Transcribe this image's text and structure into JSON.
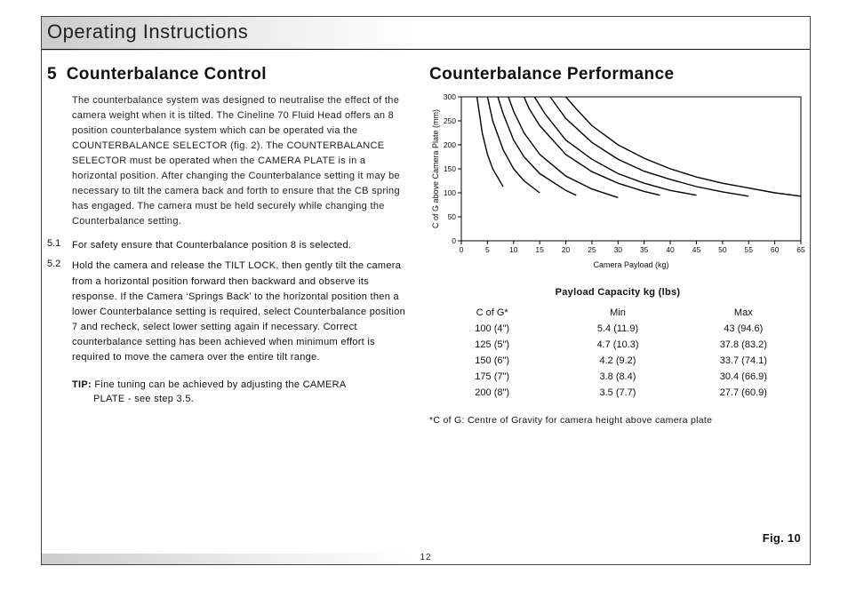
{
  "header": {
    "title": "Operating Instructions"
  },
  "left": {
    "section_number": "5",
    "section_title": "Counterbalance Control",
    "intro": "The counterbalance system was designed to neutralise the effect of the camera weight when it is tilted. The Cineline 70 Fluid Head offers an 8 position counterbalance system which can be operated via the COUNTERBALANCE SELECTOR (fig. 2). The COUNTERBALANCE SELECTOR must be operated when the CAMERA PLATE is in a horizontal position. After changing the Counterbalance setting it may be necessary to tilt the camera back and forth to ensure that the CB spring has engaged. The camera must be held securely while changing the Counterbalance setting.",
    "items": [
      {
        "num": "5.1",
        "txt": "For safety ensure that Counterbalance position 8 is selected."
      },
      {
        "num": "5.2",
        "txt": "Hold the camera and release the TILT LOCK, then gently tilt the camera from a horizontal position forward then backward and observe its response. If the Camera ‘Springs Back’ to the horizontal position then a lower Counterbalance setting is required, select Counterbalance position 7 and recheck, select lower setting again if necessary. Correct counterbalance setting has been achieved when minimum effort is required to move the camera over the entire tilt range."
      }
    ],
    "tip_label": "TIP:",
    "tip_line1": " Fine tuning can be achieved by adjusting the CAMERA",
    "tip_line2": "PLATE - see step 3.5."
  },
  "right": {
    "section_title": "Counterbalance Performance",
    "chart": {
      "xlabel": "Camera Payload (kg)",
      "ylabel": "C of G  above Camera Plate (mm)",
      "xticks": [
        "0",
        "5",
        "10",
        "15",
        "20",
        "25",
        "30",
        "35",
        "40",
        "45",
        "50",
        "55",
        "60",
        "65"
      ],
      "yticks": [
        "0",
        "50",
        "100",
        "150",
        "200",
        "250",
        "300"
      ]
    },
    "table": {
      "title": "Payload Capacity kg (lbs)",
      "head": {
        "c1": "C of G*",
        "c2": "Min",
        "c3": "Max"
      },
      "rows": [
        {
          "c1": "100 (4\")",
          "c2": "5.4 (11.9)",
          "c3": "43 (94.6)"
        },
        {
          "c1": "125 (5\")",
          "c2": "4.7 (10.3)",
          "c3": "37.8 (83.2)"
        },
        {
          "c1": "150 (6\")",
          "c2": "4.2 (9.2)",
          "c3": "33.7 (74.1)"
        },
        {
          "c1": "175 (7\")",
          "c2": "3.8 (8.4)",
          "c3": "30.4 (66.9)"
        },
        {
          "c1": "200 (8\")",
          "c2": "3.5 (7.7)",
          "c3": "27.7 (60.9)"
        }
      ]
    },
    "footnote": "*C of G: Centre of Gravity for camera height above camera plate",
    "fig_label": "Fig. 10"
  },
  "page_number": "12",
  "chart_data": {
    "type": "line",
    "title": "Counterbalance Performance",
    "xlabel": "Camera Payload (kg)",
    "ylabel": "C of G above Camera Plate (mm)",
    "xlim": [
      0,
      65
    ],
    "ylim": [
      0,
      300
    ],
    "note": "Eight hyperbolic curves, one per counterbalance position (1–8). Each curve passes through approximately C_of_G = k / payload for constant k.",
    "series": [
      {
        "name": "pos1",
        "x": [
          3,
          4,
          5,
          6,
          8
        ],
        "y": [
          300,
          225,
          180,
          150,
          113
        ]
      },
      {
        "name": "pos2",
        "x": [
          5,
          6,
          8,
          10,
          12,
          15
        ],
        "y": [
          300,
          250,
          190,
          150,
          125,
          100
        ]
      },
      {
        "name": "pos3",
        "x": [
          7,
          8,
          10,
          12,
          15,
          20,
          22
        ],
        "y": [
          300,
          265,
          210,
          175,
          140,
          105,
          95
        ]
      },
      {
        "name": "pos4",
        "x": [
          9,
          10,
          12,
          15,
          20,
          25,
          30
        ],
        "y": [
          300,
          270,
          225,
          180,
          135,
          108,
          90
        ]
      },
      {
        "name": "pos5",
        "x": [
          12,
          13,
          15,
          20,
          25,
          30,
          35,
          38
        ],
        "y": [
          300,
          275,
          240,
          180,
          144,
          120,
          103,
          95
        ]
      },
      {
        "name": "pos6",
        "x": [
          14,
          16,
          20,
          25,
          30,
          35,
          40,
          45
        ],
        "y": [
          300,
          265,
          210,
          170,
          140,
          120,
          105,
          95
        ]
      },
      {
        "name": "pos7",
        "x": [
          17,
          20,
          25,
          30,
          35,
          40,
          45,
          50,
          55
        ],
        "y": [
          300,
          255,
          205,
          170,
          145,
          128,
          113,
          102,
          93
        ]
      },
      {
        "name": "pos8",
        "x": [
          20,
          22,
          25,
          30,
          35,
          40,
          45,
          50,
          55,
          60,
          65
        ],
        "y": [
          300,
          275,
          240,
          200,
          172,
          150,
          133,
          120,
          110,
          100,
          93
        ]
      }
    ]
  }
}
